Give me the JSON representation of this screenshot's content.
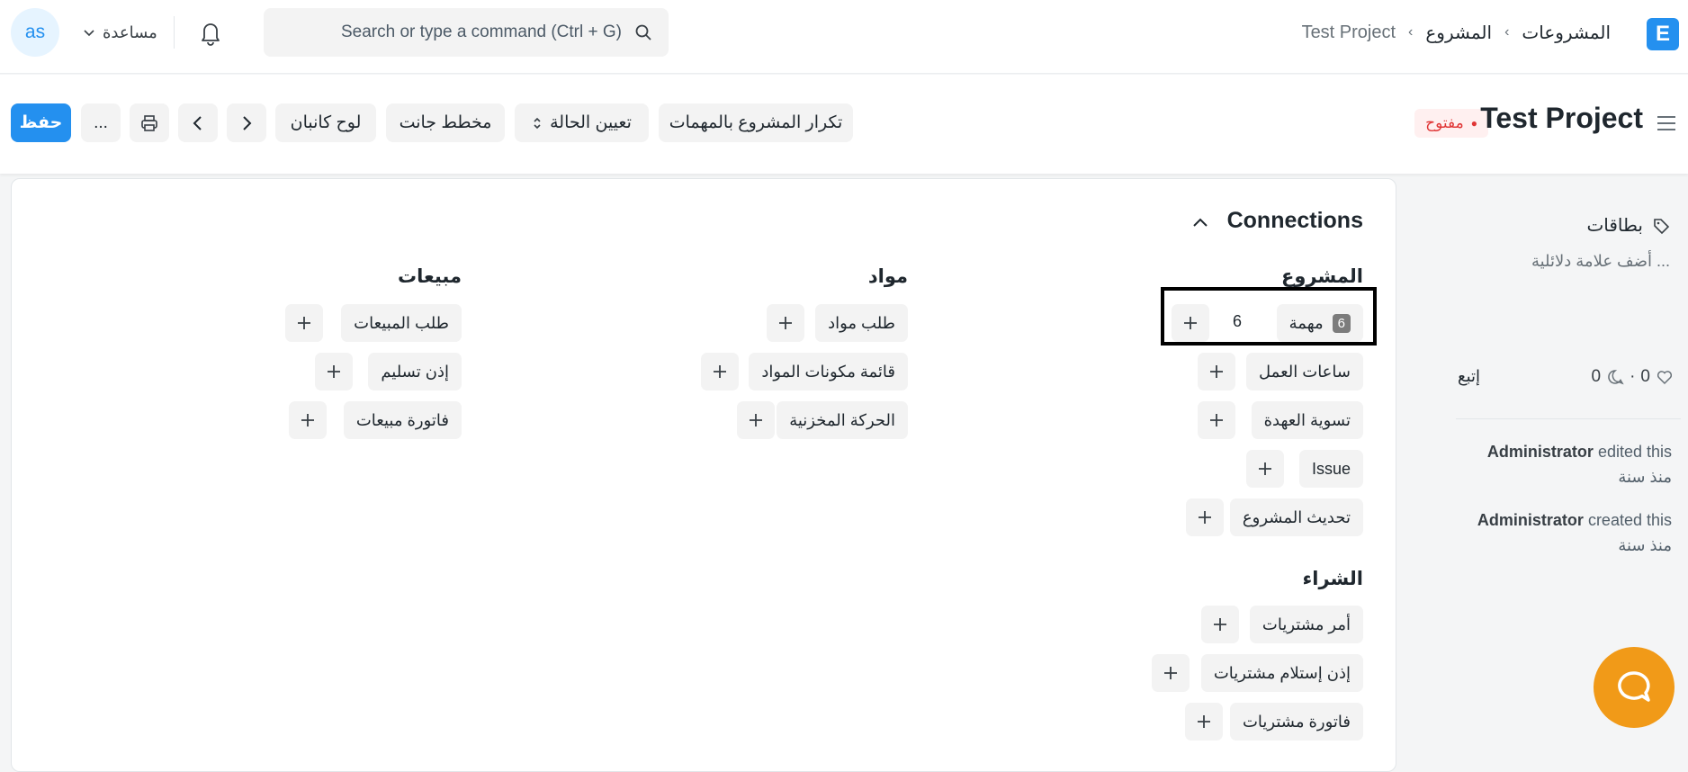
{
  "topbar": {
    "avatar": "as",
    "help_label": "مساعدة",
    "search_placeholder": "Search or type a command (Ctrl + G)",
    "breadcrumb": [
      "المشروعات",
      "المشروع",
      "Test Project"
    ],
    "logo_letter": "E"
  },
  "header": {
    "title": "Test Project",
    "status": "مفتوح",
    "buttons": {
      "duplicate": "تكرار المشروع بالمهمات",
      "set_status": "تعيين الحالة",
      "gantt": "مخطط جانت",
      "kanban": "لوح كانبان",
      "save": "حفظ",
      "more": "..."
    }
  },
  "connections": {
    "title": "Connections",
    "groups": {
      "project": {
        "heading": "المشروع",
        "items": [
          "مهمة",
          "ساعات العمل",
          "تسوية العهدة",
          "Issue",
          "تحديث المشروع"
        ],
        "task_count": "6",
        "task_count_text": "6"
      },
      "materials": {
        "heading": "مواد",
        "items": [
          "طلب مواد",
          "قائمة مكونات المواد",
          "الحركة المخزنية"
        ]
      },
      "sales": {
        "heading": "مبيعات",
        "items": [
          "طلب المبيعات",
          "إذن تسليم",
          "فاتورة مبيعات"
        ]
      },
      "purchase": {
        "heading": "الشراء",
        "items": [
          "أمر مشتريات",
          "إذن إستلام مشتريات",
          "فاتورة مشتريات"
        ]
      }
    }
  },
  "sidebar": {
    "tags_label": "بطاقات",
    "add_tag": "أضف علامة دلائلية ...",
    "follow": "إتبع",
    "likes": "0",
    "comments": "0",
    "activity": [
      {
        "user": "Administrator",
        "action": "edited this",
        "time": "منذ سنة"
      },
      {
        "user": "Administrator",
        "action": "created this",
        "time": "منذ سنة"
      }
    ]
  },
  "colors": {
    "primary": "#2490ef",
    "status_red": "#e03636",
    "chat": "#f19a18"
  }
}
